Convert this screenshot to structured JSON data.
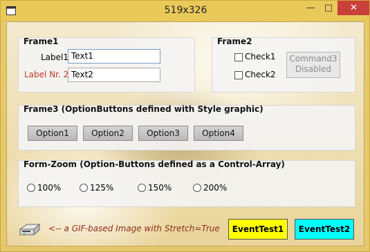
{
  "window": {
    "title": "519x326"
  },
  "frame1": {
    "title": "Frame1",
    "label1": "Label1",
    "text1": "Text1",
    "label2": "Label Nr. 2",
    "text2": "Text2"
  },
  "frame2": {
    "title": "Frame2",
    "check1": "Check1",
    "check2": "Check2",
    "command3_line1": "Command3",
    "command3_line2": "Disabled"
  },
  "frame3": {
    "title": "Frame3 (OptionButtons defined with Style graphic)",
    "options": [
      "Option1",
      "Option2",
      "Option3",
      "Option4"
    ]
  },
  "zoom": {
    "title": "Form-Zoom (Option-Buttons defined as a Control-Array)",
    "options": [
      "100%",
      "125%",
      "150%",
      "200%"
    ]
  },
  "bottom": {
    "caption": "<-- a GIF-based Image with Stretch=True",
    "event1": "EventTest1",
    "event2": "EventTest2"
  },
  "colors": {
    "event1_bg": "#ffff00",
    "event2_bg": "#00ffff",
    "caption": "#8b2e1c",
    "label2": "#c0392b"
  }
}
